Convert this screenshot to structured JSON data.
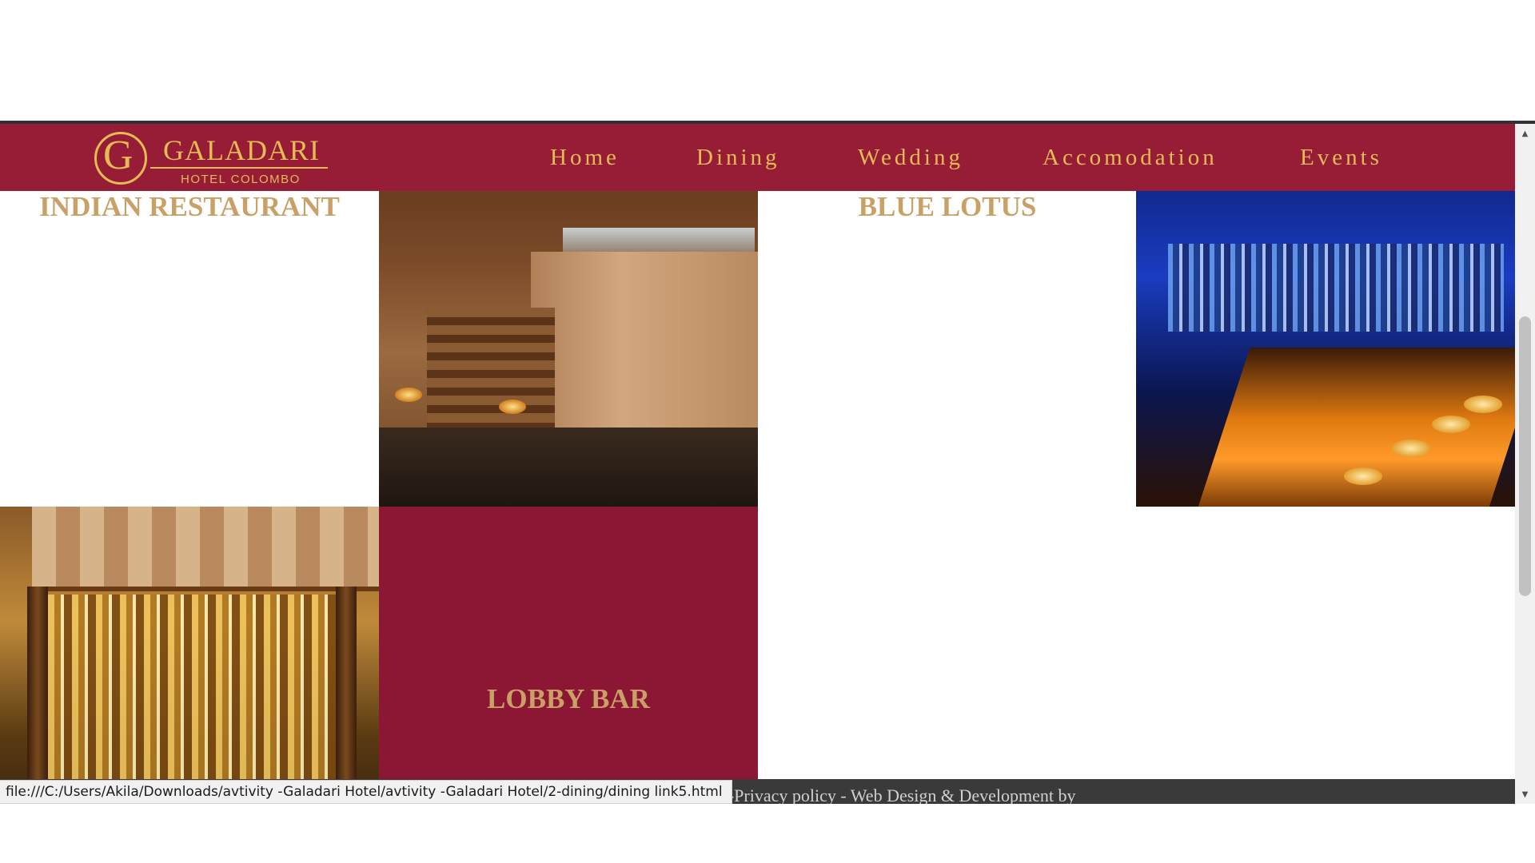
{
  "navbar": {
    "logo": {
      "letter": "G",
      "name": "GALADARI",
      "sub": "HOTEL COLOMBO"
    },
    "items": [
      {
        "label": "Home"
      },
      {
        "label": "Dining"
      },
      {
        "label": "Wedding"
      },
      {
        "label": "Accomodation"
      },
      {
        "label": "Events"
      }
    ]
  },
  "dining": {
    "cells": [
      {
        "title": "INDIAN RESTAURANT"
      },
      {
        "title": "BLUE LOTUS"
      },
      {
        "title": "LOBBY BAR"
      }
    ]
  },
  "footer": {
    "text": "erved-Privacy policy - Web Design & Development by"
  },
  "status": {
    "url": "file:///C:/Users/Akila/Downloads/avtivity -Galadari Hotel/avtivity -Galadari Hotel/2-dining/dining link5.html"
  },
  "scroll": {
    "position_fraction": 0.48
  },
  "colors": {
    "navbar_bg": "#971c35",
    "gold": "#e5bb56",
    "title_gold": "#c9a066",
    "panel_maroon": "#8c1734"
  },
  "icons": {
    "scroll_up": "triangle-up-icon",
    "scroll_down": "triangle-down-icon"
  }
}
